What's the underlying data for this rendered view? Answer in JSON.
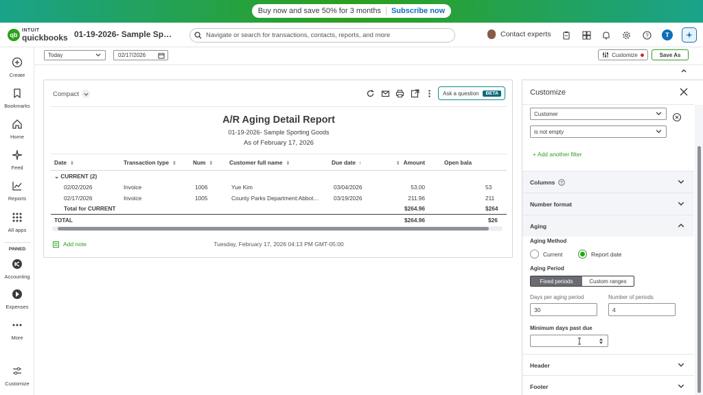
{
  "colors": {
    "brand_green": "#2ca01c",
    "link_blue": "#0d6fb8",
    "text": "#393a3d"
  },
  "promo": {
    "text": "Buy now and save 50% for 3 months",
    "cta": "Subscribe now"
  },
  "header": {
    "logo_intuit": "INTUIT",
    "logo_qb": "quickbooks",
    "logo_badge": "qb",
    "company": "01-19-2026- Sample Sp…",
    "search_placeholder": "Navigate or search for transactions, contacts, reports, and more",
    "contact": "Contact experts",
    "user_initial": "T",
    "icons": [
      "clipboard-icon",
      "apps-icon",
      "bell-icon",
      "gear-icon",
      "help-icon",
      "user-avatar",
      "assistant-icon"
    ]
  },
  "nav": {
    "items": [
      {
        "label": "Create",
        "icon": "plus-circle-icon"
      },
      {
        "label": "Bookmarks",
        "icon": "bookmark-icon"
      },
      {
        "label": "Home",
        "icon": "home-icon"
      },
      {
        "label": "Feed",
        "icon": "sparkle-icon"
      },
      {
        "label": "Reports",
        "icon": "chart-icon"
      },
      {
        "label": "All apps",
        "icon": "grid-icon"
      }
    ],
    "pinned_label": "PINNED",
    "pinned": [
      {
        "label": "Accounting",
        "icon": "accounting-icon"
      },
      {
        "label": "Expenses",
        "icon": "expenses-icon"
      },
      {
        "label": "More",
        "icon": "more-icon"
      }
    ],
    "customize": "Customize"
  },
  "toolbar": {
    "period": "Today",
    "date": "02/17/2026",
    "customize": "Customize",
    "save_as": "Save As"
  },
  "report": {
    "view": "Compact",
    "ask": "Ask a question",
    "beta": "BETA",
    "title": "A/R Aging Detail Report",
    "company": "01-19-2026- Sample Sporting Goods",
    "as_of": "As of February 17, 2026",
    "columns": [
      "Date",
      "Transaction type",
      "Num",
      "Customer full name",
      "Due date",
      "Amount",
      "Open bala"
    ],
    "group": "CURRENT (2)",
    "rows": [
      {
        "date": "02/02/2026",
        "type": "Invoice",
        "num": "1006",
        "customer": "Yue Kim",
        "due": "03/04/2026",
        "amount": "53.00",
        "open": "53"
      },
      {
        "date": "02/17/2026",
        "type": "Invoice",
        "num": "1005",
        "customer": "County Parks Department:Abbot…",
        "due": "03/19/2026",
        "amount": "211.96",
        "open": "211"
      }
    ],
    "subtotal_label": "Total for CURRENT",
    "subtotal_amount": "$264.96",
    "subtotal_open": "$264",
    "total_label": "TOTAL",
    "total_amount": "$264.96",
    "total_open": "$26",
    "add_note": "Add note",
    "timestamp": "Tuesday, February 17, 2026 04:13 PM GMT-05:00"
  },
  "customize": {
    "title": "Customize",
    "filter_field": "Customer",
    "filter_op": "is not empty",
    "add_filter": "+ Add another filter",
    "sections": {
      "columns": "Columns",
      "number_format": "Number format",
      "aging": "Aging",
      "header": "Header",
      "footer": "Footer"
    },
    "aging_method_label": "Aging Method",
    "aging_method_current": "Current",
    "aging_method_report": "Report date",
    "aging_method_selected": "Report date",
    "aging_period_label": "Aging Period",
    "fixed_periods": "Fixed periods",
    "custom_ranges": "Custom ranges",
    "days_label": "Days per aging period",
    "days_value": "30",
    "periods_label": "Number of periods",
    "periods_value": "4",
    "min_days_label": "Minimum days past due",
    "min_days_value": ""
  }
}
